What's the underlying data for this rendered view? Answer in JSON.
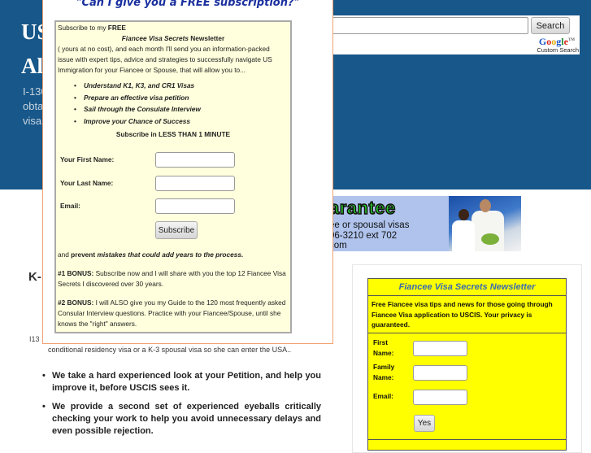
{
  "header": {
    "title_line1": "US",
    "title_line2": "Al",
    "description_lines": [
      "I-130",
      "obta",
      "visa"
    ]
  },
  "search": {
    "input_value": "",
    "button_label": "Search",
    "google_letters": [
      "G",
      "o",
      "o",
      "g",
      "l",
      "e"
    ],
    "google_tm": "TM",
    "custom_search_label": "Custom Search"
  },
  "ad": {
    "headline": "arantee",
    "lines": [
      "ee or spousal visas",
      "06-3210 ext 702",
      "com"
    ]
  },
  "main": {
    "heading": "K-",
    "i130_fragment": "I13",
    "conditional_text": "conditional residency visa or a K-3 spousal visa so she can enter the USA..",
    "bullets": [
      "We take a hard experienced look at your Petition, and help you improve it, before USCIS sees it.",
      "We provide a second set of experienced eyeballs critically checking your work to help you avoid unnecessary delays and even possible rejection."
    ]
  },
  "newsletter": {
    "title": "Fiancee Visa Secrets Newsletter",
    "description": "Free Fiancee visa tips and news for those going through Fiancee Visa application to USCIS. Your privacy is guaranteed.",
    "fields": [
      {
        "label_line1": "First",
        "label_line2": "Name:",
        "value": ""
      },
      {
        "label_line1": "Family",
        "label_line2": "Name:",
        "value": ""
      },
      {
        "label_line1": "Email:",
        "label_line2": "",
        "value": ""
      }
    ],
    "submit_label": "Yes"
  },
  "popup": {
    "title": "\"Can I give you a FREE subscription?\"",
    "intro_prefix": "Subscribe to my ",
    "intro_free": "FREE",
    "newsletter_name_italic": "Fiancee Visa Secrets",
    "newsletter_name_suffix": " Newsletter",
    "intro_lines": [
      "( yours at no cost), and each month I'll send you an information-packed",
      "issue with expert tips, advice and strategies to successfully navigate US",
      "Immigration for your Fiancee or Spouse, that will allow you to..."
    ],
    "benefits": [
      "Understand K1, K3, and CR1 Visas",
      "Prepare an effective visa petition",
      "Sail through the Consulate Interview",
      "Improve your Chance of Success"
    ],
    "subscribe_heading": "Subscribe in LESS THAN 1 MINUTE",
    "fields": [
      {
        "label": "Your First Name:",
        "value": ""
      },
      {
        "label": "Your Last Name:",
        "value": ""
      },
      {
        "label": "Email:",
        "value": ""
      }
    ],
    "subscribe_button": "Subscribe",
    "prevent_prefix": "and ",
    "prevent_bold": "prevent ",
    "prevent_italic": "mistakes that could add years to the process.",
    "bonus1_label": "#1 BONUS:",
    "bonus1_lines": [
      " Subscribe now and I will share with you the top 12 Fiancee Visa",
      "Secrets I discovered over 30 years."
    ],
    "bonus2_label": "#2 BONUS:",
    "bonus2_lines": [
      " I will ALSO give you my Guide to the 120 most frequently asked",
      "Consular Interview questions. Practice with your Fiancee/Spouse, until she",
      "knows the \"right\" answers."
    ]
  },
  "colors": {
    "banner": "#175789",
    "popup_border": "#f0a070",
    "popup_inner_bg": "#ffffdd",
    "newsletter_bg": "#ffff00",
    "popup_title": "#1a2f9f"
  }
}
